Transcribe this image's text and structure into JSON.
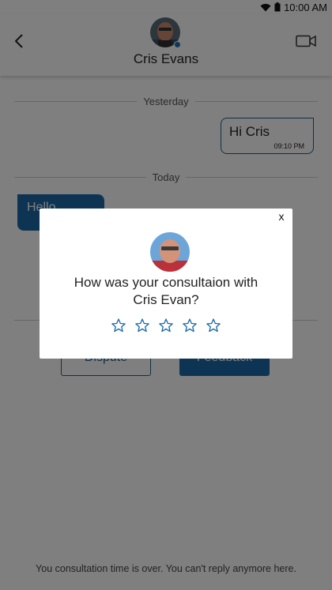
{
  "status_bar": {
    "time": "10:00 AM"
  },
  "header": {
    "contact_name": "Cris Evans"
  },
  "chat": {
    "day_labels": [
      "Yesterday",
      "Today"
    ],
    "messages": [
      {
        "direction": "outgoing",
        "text": "Hi Cris",
        "time": "09:10 PM"
      },
      {
        "direction": "incoming",
        "text": "Hello"
      }
    ]
  },
  "actions": {
    "dispute_label": "Dispute",
    "feedback_label": "Feedback"
  },
  "footer": {
    "note": "You consultation time is over. You can't reply anymore here."
  },
  "rating_modal": {
    "close_label": "x",
    "question_line1": "How was your consultaion with",
    "question_line2": "Cris  Evan?",
    "star_count": 5,
    "selected_rating": 0
  },
  "colors": {
    "accent": "#1b6aa7",
    "online": "#1f6fb2",
    "overlay": "rgba(0,0,0,0.5)"
  }
}
